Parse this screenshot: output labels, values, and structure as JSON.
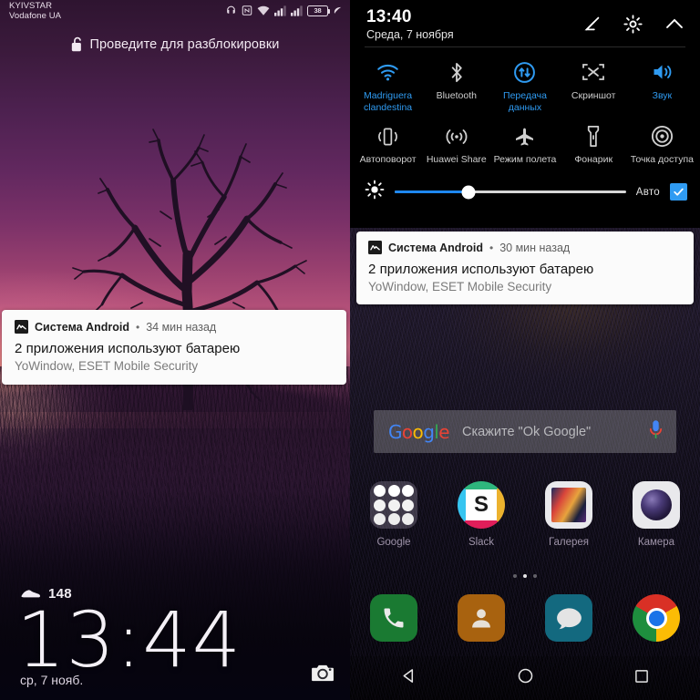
{
  "lockscreen": {
    "status_bar": {
      "carrier_1": "KYIVSTAR",
      "carrier_2": "Vodafone UA",
      "icons": [
        "headset-icon",
        "nfc-icon",
        "wifi-icon",
        "signal-sim1-icon",
        "signal-sim2-icon",
        "battery-icon",
        "power-saving-leaf-icon"
      ],
      "battery_percent": "38"
    },
    "unlock_hint": "Проведите для разблокировки",
    "notification": {
      "app_name": "Система Android",
      "separator": "•",
      "time": "34 мин назад",
      "title": "2 приложения используют батарею",
      "body": "YoWindow, ESET Mobile Security"
    },
    "steps_count": "148",
    "clock": "13:44",
    "date": "ср, 7 нояб.",
    "camera_shortcut": "camera-icon"
  },
  "homescreen": {
    "quick_settings": {
      "time": "13:40",
      "date": "Среда, 7 ноября",
      "actions": [
        "edit-icon",
        "gear-icon",
        "chevron-up-icon"
      ],
      "accent_color": "#2f9bf2",
      "tiles": [
        {
          "icon": "wifi-icon",
          "label": "Madriguera clandestina",
          "active": true
        },
        {
          "icon": "bluetooth-icon",
          "label": "Bluetooth",
          "active": false
        },
        {
          "icon": "mobile-data-icon",
          "label": "Передача данных",
          "active": true
        },
        {
          "icon": "screenshot-icon",
          "label": "Скриншот",
          "active": false
        },
        {
          "icon": "sound-icon",
          "label": "Звук",
          "active": true
        },
        {
          "icon": "auto-rotate-icon",
          "label": "Автоповорот",
          "active": false
        },
        {
          "icon": "huawei-share-icon",
          "label": "Huawei Share",
          "active": false
        },
        {
          "icon": "airplane-icon",
          "label": "Режим полета",
          "active": false
        },
        {
          "icon": "flashlight-icon",
          "label": "Фонарик",
          "active": false
        },
        {
          "icon": "hotspot-icon",
          "label": "Точка доступа",
          "active": false
        }
      ],
      "brightness": {
        "icon": "brightness-icon",
        "value_percent": 32,
        "auto_label": "Авто",
        "auto_checked": true
      }
    },
    "notification": {
      "app_name": "Система Android",
      "separator": "•",
      "time": "30 мин назад",
      "title": "2 приложения используют батарею",
      "body": "YoWindow, ESET Mobile Security"
    },
    "search_bar": {
      "logo_letters": [
        "G",
        "o",
        "o",
        "g",
        "l",
        "e"
      ],
      "placeholder": "Скажите \"Ok Google\"",
      "mic_icon": "microphone-icon"
    },
    "apps": [
      {
        "label": "Google",
        "icon": "google-folder-icon"
      },
      {
        "label": "Slack",
        "icon": "slack-icon"
      },
      {
        "label": "Галерея",
        "icon": "gallery-icon"
      },
      {
        "label": "Камера",
        "icon": "camera-app-icon"
      }
    ],
    "page_dots": {
      "count": 3,
      "active_index": 1
    },
    "dock": [
      {
        "label": "phone",
        "icon": "phone-icon"
      },
      {
        "label": "contacts",
        "icon": "contacts-icon"
      },
      {
        "label": "messages",
        "icon": "messages-icon"
      },
      {
        "label": "chrome",
        "icon": "chrome-icon"
      }
    ],
    "navbar": [
      "back-icon",
      "home-icon",
      "recents-icon"
    ]
  }
}
